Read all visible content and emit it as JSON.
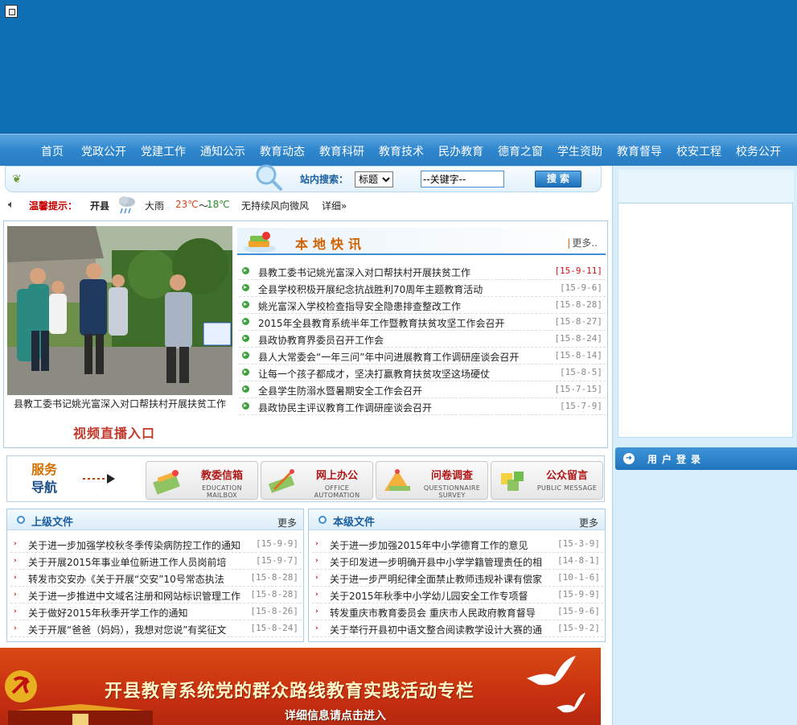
{
  "nav": {
    "items": [
      "首页",
      "党政公开",
      "党建工作",
      "通知公示",
      "教育动态",
      "教育科研",
      "教育技术",
      "民办教育",
      "德育之窗",
      "学生资助",
      "教育督导",
      "校安工程",
      "校务公开"
    ]
  },
  "search": {
    "label": "站内搜索：",
    "select_value": "标题",
    "input_value": "--关键字--",
    "button_label": "搜索"
  },
  "tip": {
    "label": "温馨提示：",
    "city": "开县",
    "weather": "大雨",
    "temp_high": "23℃",
    "temp_sep": "～",
    "temp_low": "18℃",
    "wind": "无持续风向微风",
    "detail": "详细»"
  },
  "featured": {
    "caption": "县教工委书记姚光富深入对口帮扶村开展扶贫工作",
    "video_entry": "视频直播入口"
  },
  "news": {
    "title": "本地快讯",
    "more": "更多..",
    "items": [
      {
        "title": "县教工委书记姚光富深入对口帮扶村开展扶贫工作",
        "date": "[15-9-11]"
      },
      {
        "title": "全县学校积极开展纪念抗战胜利70周年主题教育活动",
        "date": "[15-9-6]"
      },
      {
        "title": "姚光富深入学校检查指导安全隐患排查整改工作",
        "date": "[15-8-28]"
      },
      {
        "title": "2015年全县教育系统半年工作暨教育扶贫攻坚工作会召开",
        "date": "[15-8-27]"
      },
      {
        "title": "县政协教育界委员召开工作会",
        "date": "[15-8-24]"
      },
      {
        "title": "县人大常委会“一年三问”年中问进展教育工作调研座谈会召开",
        "date": "[15-8-14]"
      },
      {
        "title": "让每一个孩子都成才，坚决打赢教育扶贫攻坚这场硬仗",
        "date": "[15-8-5]"
      },
      {
        "title": "全县学生防溺水暨暑期安全工作会召开",
        "date": "[15-7-15]"
      },
      {
        "title": "县政协民主评议教育工作调研座谈会召开",
        "date": "[15-7-9]"
      }
    ]
  },
  "service": {
    "title_1": "服务",
    "title_2": "导航",
    "items": [
      {
        "cn": "教委信箱",
        "en": "EDUCATION MAILBOX"
      },
      {
        "cn": "网上办公",
        "en": "OFFICE AUTOMATION"
      },
      {
        "cn": "问卷调查",
        "en": "QUESTIONNAIRE SURVEY"
      },
      {
        "cn": "公众留言",
        "en": "PUBLIC MESSAGE"
      }
    ]
  },
  "upper_docs": {
    "title": "上级文件",
    "more": "更多",
    "items": [
      {
        "title": "关于进一步加强学校秋冬季传染病防控工作的通知",
        "date": "[15-9-9]"
      },
      {
        "title": "关于开展2015年事业单位新进工作人员岗前培",
        "date": "[15-9-7]"
      },
      {
        "title": "转发市交安办《关于开展“交安”10号常态执法",
        "date": "[15-8-28]"
      },
      {
        "title": "关于进一步推进中文域名注册和网站标识管理工作",
        "date": "[15-8-28]"
      },
      {
        "title": "关于做好2015年秋季开学工作的通知",
        "date": "[15-8-26]"
      },
      {
        "title": "关于开展“爸爸（妈妈），我想对您说”有奖征文",
        "date": "[15-8-24]"
      }
    ]
  },
  "local_docs": {
    "title": "本级文件",
    "more": "更多",
    "items": [
      {
        "title": "关于进一步加强2015年中小学德育工作的意见",
        "date": "[15-3-9]"
      },
      {
        "title": "关于印发进一步明确开县中小学学籍管理责任的相",
        "date": "[14-8-1]"
      },
      {
        "title": "关于进一步严明纪律全面禁止教师违规补课有偿家",
        "date": "[10-1-6]"
      },
      {
        "title": "关于2015年秋季中小学幼儿园安全工作专项督",
        "date": "[15-9-9]"
      },
      {
        "title": "转发重庆市教育委员会 重庆市人民政府教育督导",
        "date": "[15-9-6]"
      },
      {
        "title": "关于举行开县初中语文整合阅读教学设计大赛的通",
        "date": "[15-9-2]"
      }
    ]
  },
  "party_banner": {
    "title": "开县教育系统党的群众路线教育实践活动专栏",
    "subtitle": "详细信息请点击进入"
  },
  "login": {
    "title": "用户登录"
  },
  "colors": {
    "banner": "#0e6fb4",
    "nav": "#2e86cc",
    "accent_red": "#c0392b",
    "news_title": "#d06000"
  }
}
